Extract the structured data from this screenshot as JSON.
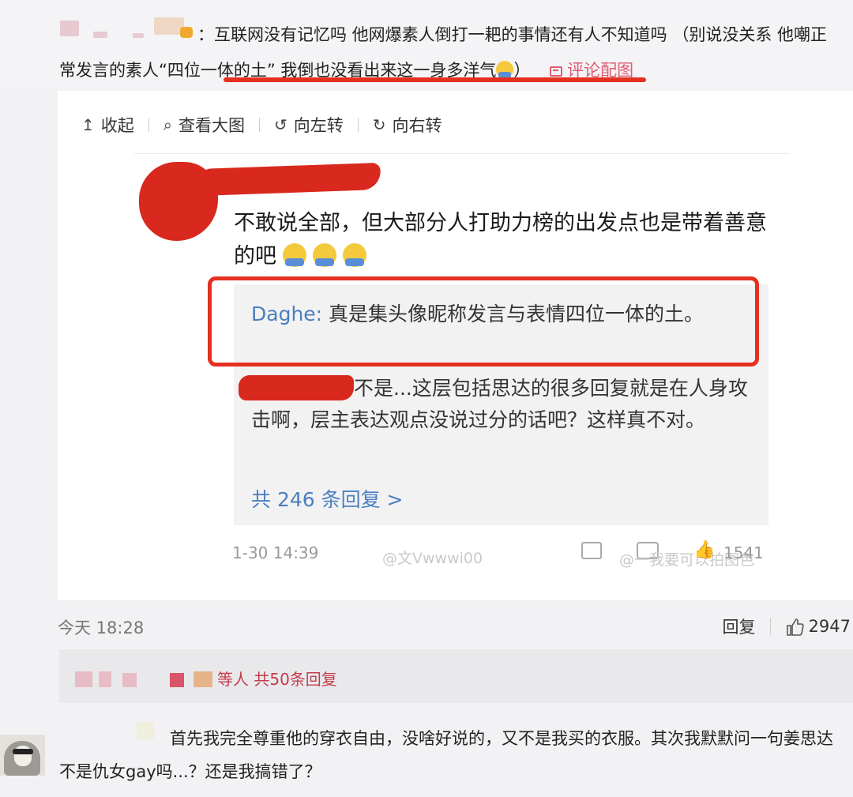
{
  "comment1": {
    "text_part1": "：互联网没有记忆吗 他网爆素人倒打一耙的事情还有人不知道吗 （别说没关系 他嘲正常发言的素人“四位一体的土” 我倒也没看出来这一身多洋气",
    "text_part2": "）",
    "attach_label": "评论配图"
  },
  "viewer": {
    "collapse": "收起",
    "view_large": "查看大图",
    "rotate_left": "向左转",
    "rotate_right": "向右转",
    "collapse_icon": "↥",
    "view_icon": "⌕",
    "rotate_left_icon": "↺",
    "rotate_right_icon": "↻"
  },
  "screenshot": {
    "post_text": "不敢说全部，但大部分人打助力榜的出发点也是带着善意的吧",
    "reply1_name": "Daghe:",
    "reply1_text": " 真是集头像昵称发言与表情四位一体的土。",
    "reply2_text": "不是...这层包括思达的很多回复就是在人身攻击啊，层主表达观点没说过分的话吧？这样真不对。",
    "more_replies": "共 246 条回复 >",
    "time": "1-30 14:39",
    "likes": "1541",
    "watermark1": "@文Vwwwi00",
    "watermark2": "@一我要可以拍图色"
  },
  "comment1_meta": {
    "time": "今天 18:28",
    "reply_label": "回复",
    "like_count": "2947"
  },
  "comment2": {
    "label": "等人 共50条回复"
  },
  "comment3": {
    "text": "首先我完全尊重他的穿衣自由，没啥好说的，又不是我买的衣服。其次我默默问一句姜思达不是仇女gay吗...？还是我搞错了？"
  },
  "colors": {
    "accent_red": "#e5301f",
    "link_blue": "#4a7fbf",
    "pink": "#e05a6f"
  }
}
